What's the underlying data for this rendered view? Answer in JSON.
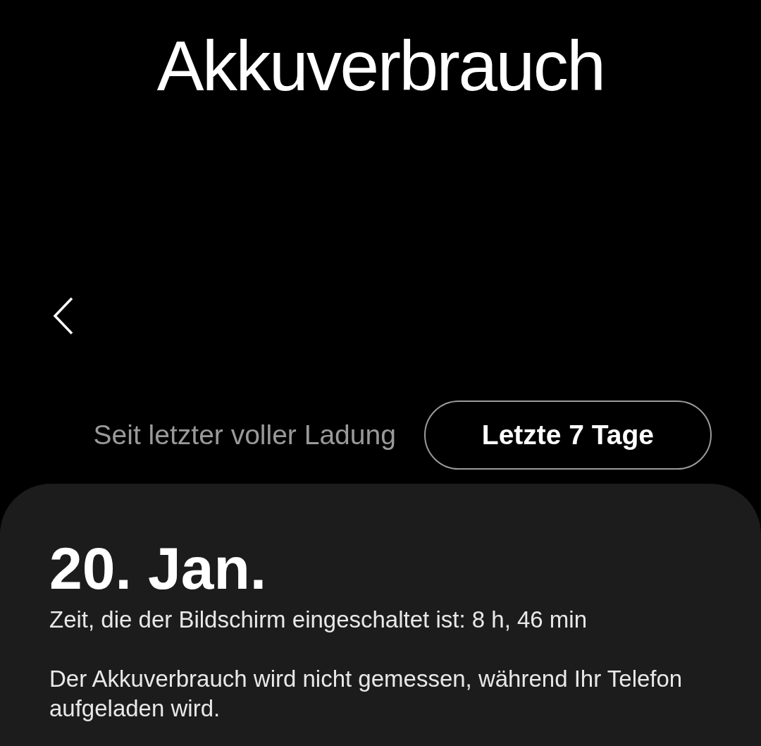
{
  "header": {
    "title": "Akkuverbrauch"
  },
  "tabs": [
    {
      "label": "Seit letzter voller Ladung",
      "selected": false
    },
    {
      "label": "Letzte 7 Tage",
      "selected": true
    }
  ],
  "card": {
    "date": "20. Jan.",
    "screen_time": "Zeit, die der Bildschirm eingeschaltet ist: 8 h, 46 min",
    "note": "Der Akkuverbrauch wird nicht gemessen, während Ihr Telefon aufgeladen wird."
  }
}
